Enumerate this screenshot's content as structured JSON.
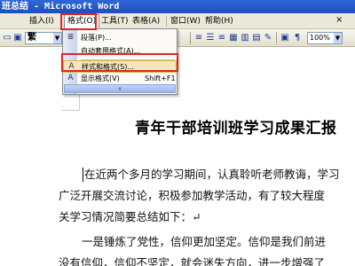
{
  "window": {
    "title": "班总结 - Microsoft Word"
  },
  "menubar": {
    "items": [
      {
        "label": "插入(I)"
      },
      {
        "label": "格式(O)"
      },
      {
        "label": "工具(T)"
      },
      {
        "label": "表格(A)"
      },
      {
        "label": "窗口(W)"
      },
      {
        "label": "帮助(H)"
      }
    ],
    "close_glyph": "×"
  },
  "toolbar": {
    "font_value": "繁",
    "zoom_value": "100%"
  },
  "format_menu": {
    "items": [
      {
        "label": "段落(P)...",
        "shortcut": "",
        "icon": "paragraph-icon"
      },
      {
        "label": "自动套用格式(A)...",
        "shortcut": "",
        "icon": ""
      },
      {
        "label": "样式和格式(S)...",
        "shortcut": "",
        "icon": "styles-icon"
      },
      {
        "label": "显示格式(V)",
        "shortcut": "Shift+F1",
        "icon": "reveal-format-icon"
      }
    ],
    "expand_glyph": "»"
  },
  "document": {
    "heading": "青年干部培训班学习成果汇报",
    "lines": [
      "在近两个多月的学习期间，认真聆听老师教诲，学习",
      "广泛开展交流讨论，积极参加教学活动，有了较大程度",
      "关学习情况简要总结如下：↵",
      "一是锤炼了党性，信仰更加坚定。信仰是我们前进",
      "没有信仰，信仰不坚定，就会迷失方向，进一步增强了"
    ]
  },
  "highlight_color": "#e0242a"
}
